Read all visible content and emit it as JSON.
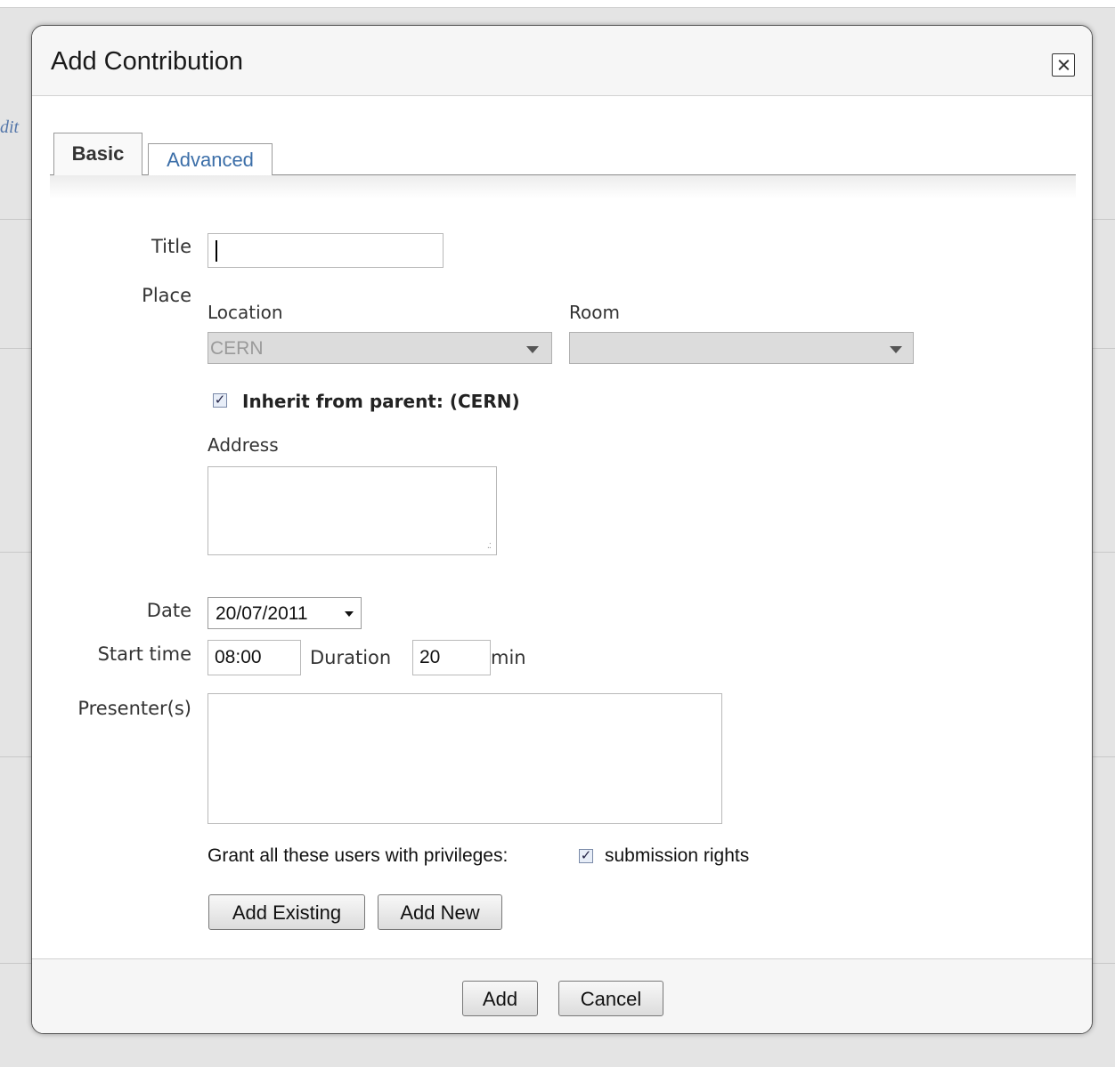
{
  "background": {
    "crumb_text": "dit"
  },
  "dialog": {
    "title": "Add Contribution",
    "tabs": [
      {
        "label": "Basic",
        "active": true
      },
      {
        "label": "Advanced",
        "active": false
      }
    ]
  },
  "form": {
    "title_label": "Title",
    "title_value": "",
    "place_label": "Place",
    "location_label": "Location",
    "location_value": "CERN",
    "room_label": "Room",
    "room_value": "",
    "inherit_label": "Inherit from parent: (CERN)",
    "inherit_checked": true,
    "address_label": "Address",
    "address_value": "",
    "date_label": "Date",
    "date_value": "20/07/2011",
    "start_time_label": "Start time",
    "start_time_value": "08:00",
    "duration_label": "Duration",
    "duration_value": "20",
    "duration_unit": "min",
    "presenters_label": "Presenter(s)",
    "grant_label": "Grant all these users with privileges:",
    "submission_label": "submission rights",
    "submission_checked": true,
    "add_existing_label": "Add Existing",
    "add_new_label": "Add New"
  },
  "footer": {
    "add_label": "Add",
    "cancel_label": "Cancel"
  }
}
